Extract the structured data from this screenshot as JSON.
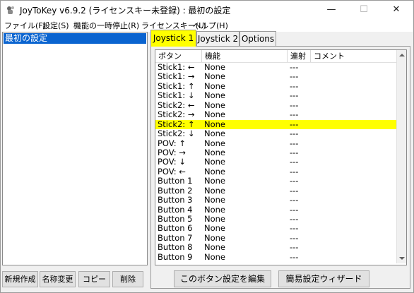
{
  "window": {
    "title": "JoyToKey v6.9.2 (ライセンスキー未登録) : 最初の設定",
    "minimize": "—",
    "maximize": "☐",
    "close": "✕"
  },
  "menu": [
    "ファイル(F)",
    "設定(S)",
    "機能の一時停止(R)",
    "ライセンスキー(L)",
    "ヘルプ(H)"
  ],
  "config_list": {
    "items": [
      "最初の設定"
    ],
    "selected": "最初の設定"
  },
  "left_buttons": {
    "new": "新規作成",
    "rename": "名称変更",
    "copy": "コピー",
    "delete": "削除"
  },
  "tabs": [
    {
      "label": "Joystick 1",
      "active": true
    },
    {
      "label": "Joystick 2",
      "active": false
    },
    {
      "label": "Options",
      "active": false
    }
  ],
  "table": {
    "columns": [
      "ボタン",
      "機能",
      "連射",
      "コメント"
    ],
    "rows": [
      {
        "button": "Stick1: ←",
        "function": "None",
        "rapid": "---",
        "comment": ""
      },
      {
        "button": "Stick1: →",
        "function": "None",
        "rapid": "---",
        "comment": ""
      },
      {
        "button": "Stick1: ↑",
        "function": "None",
        "rapid": "---",
        "comment": ""
      },
      {
        "button": "Stick1: ↓",
        "function": "None",
        "rapid": "---",
        "comment": ""
      },
      {
        "button": "Stick2: ←",
        "function": "None",
        "rapid": "---",
        "comment": ""
      },
      {
        "button": "Stick2: →",
        "function": "None",
        "rapid": "---",
        "comment": ""
      },
      {
        "button": "Stick2: ↑",
        "function": "None",
        "rapid": "---",
        "comment": "",
        "highlighted": true
      },
      {
        "button": "Stick2: ↓",
        "function": "None",
        "rapid": "---",
        "comment": ""
      },
      {
        "button": "POV: ↑",
        "function": "None",
        "rapid": "---",
        "comment": ""
      },
      {
        "button": "POV: →",
        "function": "None",
        "rapid": "---",
        "comment": ""
      },
      {
        "button": "POV: ↓",
        "function": "None",
        "rapid": "---",
        "comment": ""
      },
      {
        "button": "POV: ←",
        "function": "None",
        "rapid": "---",
        "comment": ""
      },
      {
        "button": "Button 1",
        "function": "None",
        "rapid": "---",
        "comment": ""
      },
      {
        "button": "Button 2",
        "function": "None",
        "rapid": "---",
        "comment": ""
      },
      {
        "button": "Button 3",
        "function": "None",
        "rapid": "---",
        "comment": ""
      },
      {
        "button": "Button 4",
        "function": "None",
        "rapid": "---",
        "comment": ""
      },
      {
        "button": "Button 5",
        "function": "None",
        "rapid": "---",
        "comment": ""
      },
      {
        "button": "Button 6",
        "function": "None",
        "rapid": "---",
        "comment": ""
      },
      {
        "button": "Button 7",
        "function": "None",
        "rapid": "---",
        "comment": ""
      },
      {
        "button": "Button 8",
        "function": "None",
        "rapid": "---",
        "comment": ""
      },
      {
        "button": "Button 9",
        "function": "None",
        "rapid": "---",
        "comment": ""
      }
    ]
  },
  "actions": {
    "edit_button": "このボタン設定を編集",
    "wizard_button": "簡易設定ウィザード"
  },
  "colors": {
    "highlight": "#ffff00",
    "selection": "#0a64d0"
  }
}
